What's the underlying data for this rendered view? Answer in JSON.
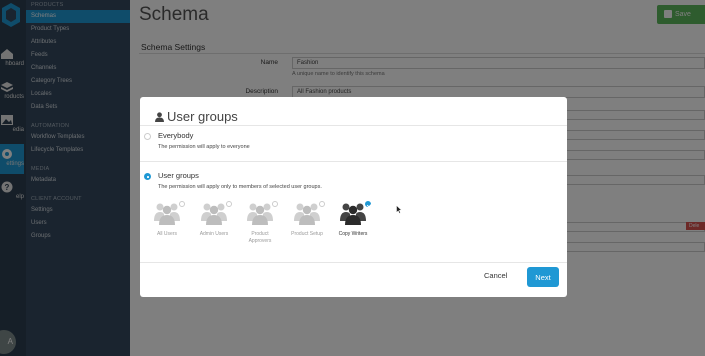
{
  "rail": {
    "items": [
      {
        "label": "hboard",
        "icon": "dashboard-icon"
      },
      {
        "label": "roducts",
        "icon": "products-icon"
      },
      {
        "label": "edia",
        "icon": "media-icon"
      },
      {
        "label": "ettings",
        "icon": "settings-icon"
      },
      {
        "label": "elp",
        "icon": "help-icon"
      }
    ],
    "avatar_initials": "A"
  },
  "submenu": {
    "products_heading": "PRODUCTS",
    "products_items": [
      "Schemas",
      "Product Types",
      "Attributes",
      "Feeds",
      "Channels",
      "Category Trees",
      "Locales",
      "Data Sets"
    ],
    "automation_heading": "AUTOMATION",
    "automation_items": [
      "Workflow Templates",
      "Lifecycle Templates"
    ],
    "media_heading": "MEDIA",
    "media_items": [
      "Metadata"
    ],
    "client_heading": "CLIENT ACCOUNT",
    "client_items": [
      "Settings",
      "Users",
      "Groups"
    ]
  },
  "page": {
    "title": "Schema",
    "save_label": "Save",
    "section_title": "Schema Settings",
    "name_label": "Name",
    "name_value": "Fashion",
    "name_help": "A unique name to identify this schema",
    "description_label": "Description",
    "description_value": "All Fashion products",
    "delete_label": "Dele"
  },
  "modal": {
    "title": "User groups",
    "everybody_title": "Everybody",
    "everybody_desc": "The permission will apply to everyone",
    "usergroups_title": "User groups",
    "usergroups_desc": "The permission will apply only to members of selected user groups.",
    "groups": [
      {
        "label": "All Users",
        "selected": false
      },
      {
        "label": "Admin Users",
        "selected": false
      },
      {
        "label": "Product Approvers",
        "selected": false
      },
      {
        "label": "Product Setup",
        "selected": false
      },
      {
        "label": "Copy Writers",
        "selected": true
      }
    ],
    "cancel_label": "Cancel",
    "next_label": "Next"
  },
  "colors": {
    "accent": "#1f98d4",
    "save_green": "#5cb85c",
    "rail_bg": "#2c3e50",
    "submenu_bg": "#35495e"
  }
}
